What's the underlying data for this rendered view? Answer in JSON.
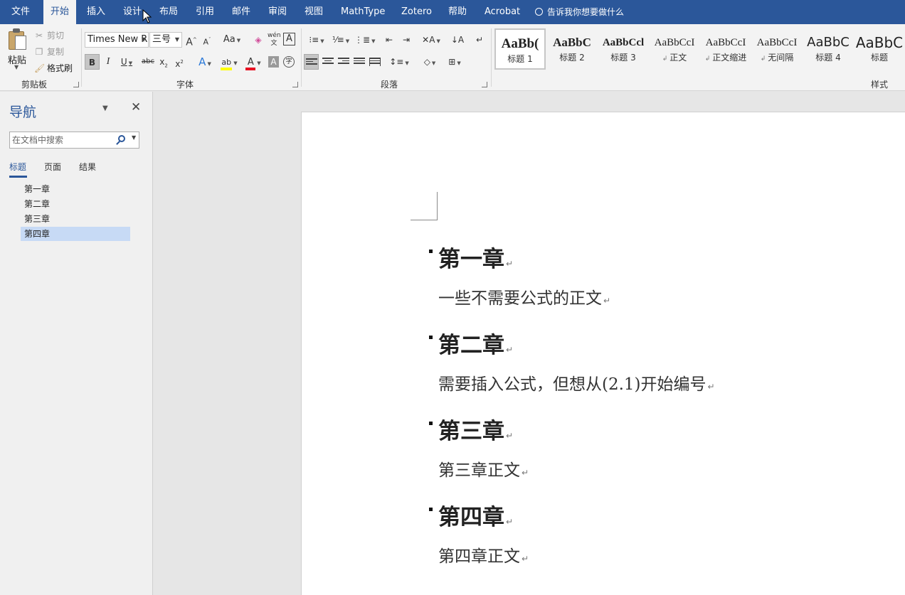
{
  "ribbon_tabs": [
    "文件",
    "开始",
    "插入",
    "设计",
    "布局",
    "引用",
    "邮件",
    "审阅",
    "视图",
    "MathType",
    "Zotero",
    "帮助",
    "Acrobat"
  ],
  "active_tab": "开始",
  "tell_me": "告诉我你想要做什么",
  "clipboard": {
    "paste": "粘贴",
    "cut": "剪切",
    "copy": "复制",
    "format_painter": "格式刷",
    "group_label": "剪贴板"
  },
  "font": {
    "font_name": "Times New R",
    "font_size": "三号",
    "change_case": "Aa",
    "group_label": "字体"
  },
  "paragraph": {
    "group_label": "段落"
  },
  "styles": {
    "group_label": "样式",
    "items": [
      {
        "sample": "AaBb(",
        "name": "标题 1"
      },
      {
        "sample": "AaBbC",
        "name": "标题 2"
      },
      {
        "sample": "AaBbCcl",
        "name": "标题 3"
      },
      {
        "sample": "AaBbCcI",
        "name": "正文"
      },
      {
        "sample": "AaBbCcI",
        "name": "正文缩进"
      },
      {
        "sample": "AaBbCcI",
        "name": "无间隔"
      },
      {
        "sample": "AaBbC",
        "name": "标题 4"
      },
      {
        "sample": "AaBbC",
        "name": "标题"
      }
    ]
  },
  "navigation": {
    "title": "导航",
    "search_placeholder": "在文档中搜索",
    "tabs": [
      "标题",
      "页面",
      "结果"
    ],
    "headings": [
      "第一章",
      "第二章",
      "第三章",
      "第四章"
    ],
    "selected_heading": "第四章"
  },
  "document": {
    "blocks": [
      {
        "heading": "第一章",
        "body": "一些不需要公式的正文"
      },
      {
        "heading": "第二章",
        "body": "需要插入公式，但想从(2.1)开始编号"
      },
      {
        "heading": "第三章",
        "body": "第三章正文"
      },
      {
        "heading": "第四章",
        "body": "第四章正文"
      }
    ]
  },
  "colors": {
    "accent": "#2b579a",
    "highlight": "#ffff00",
    "font_color": "#e81123",
    "nav_selected": "#c7daf5"
  }
}
